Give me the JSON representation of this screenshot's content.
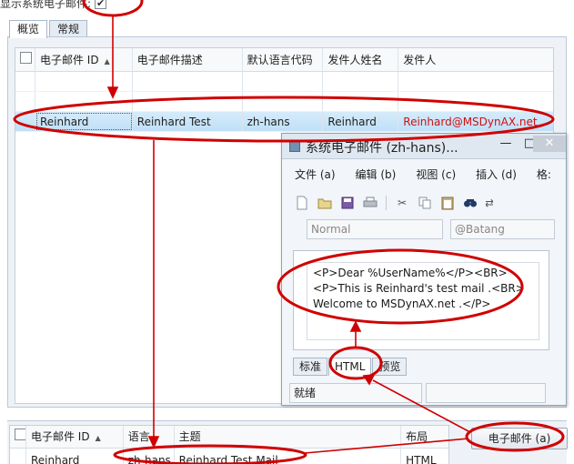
{
  "header": {
    "show_system_email_label": "显示系统电子邮件:",
    "show_system_email_checked": "✔"
  },
  "tabs": [
    {
      "label": "概览"
    },
    {
      "label": "常规"
    }
  ],
  "grid": {
    "columns": [
      "电子邮件 ID",
      "电子邮件描述",
      "默认语言代码",
      "发件人姓名",
      "发件人"
    ],
    "rows": [
      {
        "id": "Reinhard",
        "description": "Reinhard Test",
        "language": "zh-hans",
        "sender_name": "Reinhard",
        "sender": "Reinhard@MSDynAX.net"
      }
    ]
  },
  "popup": {
    "title": "系统电子邮件 (zh-hans)...",
    "controls": {
      "minimize": "—",
      "maximize": "□",
      "close": "✕"
    },
    "menu": [
      "文件 (a)",
      "编辑 (b)",
      "视图 (c)",
      "插入 (d)",
      "格:"
    ],
    "style_field": "Normal",
    "font_field": "@Batang",
    "code_lines": [
      "<P>Dear %UserName%</P><BR>",
      "<P>This is Reinhard's test mail .<BR>",
      "Welcome to MSDynAX.net .</P>"
    ],
    "tabs": [
      "标准",
      "HTML",
      "预览"
    ],
    "status": "就绪"
  },
  "lower_grid": {
    "columns": [
      "电子邮件 ID",
      "语言",
      "主题",
      "布局"
    ],
    "rows": [
      {
        "id": "Reinhard",
        "language": "zh-hans",
        "subject": "Reinhard Test Mail",
        "layout": "HTML"
      }
    ]
  },
  "email_button": "电子邮件 (a)",
  "colors": {
    "annotation": "#d00000",
    "selected_row": "#c6e4f9",
    "sender_text": "#d01010"
  },
  "icons": [
    "new-document-icon",
    "open-folder-icon",
    "save-icon",
    "print-icon",
    "cut-icon",
    "copy-icon",
    "paste-icon",
    "find-icon",
    "replace-icon"
  ]
}
